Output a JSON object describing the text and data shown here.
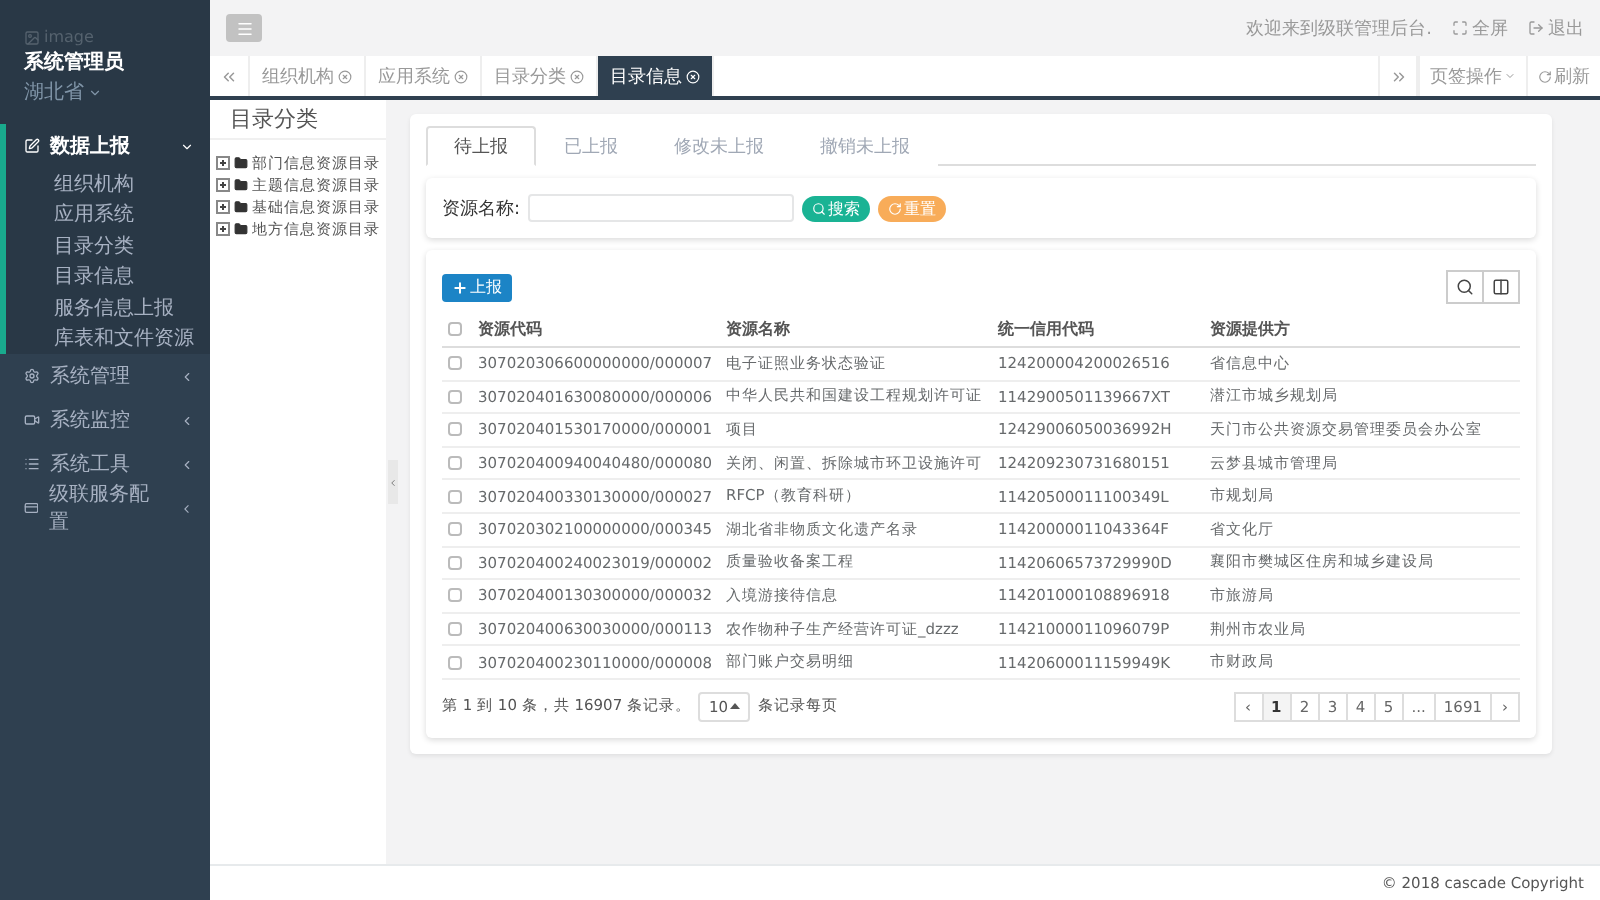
{
  "sidebar": {
    "image_label": "image",
    "user_name": "系统管理员",
    "region": "湖北省",
    "menu": [
      {
        "label": "数据上报",
        "expanded": true,
        "children": [
          {
            "label": "组织机构"
          },
          {
            "label": "应用系统"
          },
          {
            "label": "目录分类"
          },
          {
            "label": "目录信息"
          },
          {
            "label": "服务信息上报"
          },
          {
            "label": "库表和文件资源"
          }
        ]
      },
      {
        "label": "系统管理",
        "expanded": false
      },
      {
        "label": "系统监控",
        "expanded": false
      },
      {
        "label": "系统工具",
        "expanded": false
      },
      {
        "label": "级联服务配置",
        "expanded": false
      }
    ]
  },
  "header": {
    "welcome": "欢迎来到级联管理后台.",
    "fullscreen": "全屏",
    "logout": "退出"
  },
  "page_tabs": [
    {
      "label": "组织机构",
      "selected": false
    },
    {
      "label": "应用系统",
      "selected": false
    },
    {
      "label": "目录分类",
      "selected": false
    },
    {
      "label": "目录信息",
      "selected": true
    }
  ],
  "tab_actions": {
    "menu": "页签操作",
    "refresh": "刷新"
  },
  "tree": {
    "title": "目录分类",
    "items": [
      {
        "label": "部门信息资源目录",
        "expanded": false
      },
      {
        "label": "主题信息资源目录",
        "expanded": false
      },
      {
        "label": "基础信息资源目录",
        "expanded": false
      },
      {
        "label": "地方信息资源目录",
        "expanded": false
      }
    ]
  },
  "report_tabs": [
    {
      "label": "待上报",
      "selected": true
    },
    {
      "label": "已上报",
      "selected": false
    },
    {
      "label": "修改未上报",
      "selected": false
    },
    {
      "label": "撤销未上报",
      "selected": false
    }
  ],
  "search": {
    "label": "资源名称:",
    "search_button": "搜索",
    "reset_button": "重置"
  },
  "report_button": "上报",
  "table": {
    "all_checked": false,
    "columns": [
      "资源代码",
      "资源名称",
      "统一信用代码",
      "资源提供方"
    ],
    "rows": [
      {
        "checked": false,
        "cells": [
          "307020306600000000/000007",
          "电子证照业务状态验证",
          "124200004200026516",
          "省信息中心"
        ]
      },
      {
        "checked": false,
        "cells": [
          "307020401630080000/000006",
          "中华人民共和国建设工程规划许可证",
          "1142900501139667XT",
          "潜江市城乡规划局"
        ]
      },
      {
        "checked": false,
        "cells": [
          "307020401530170000/000001",
          "项目",
          "12429006050036992H",
          "天门市公共资源交易管理委员会办公室"
        ]
      },
      {
        "checked": false,
        "cells": [
          "307020400940040480/000080",
          "关闭、闲置、拆除城市环卫设施许可",
          "124209230731680151",
          "云梦县城市管理局"
        ]
      },
      {
        "checked": false,
        "cells": [
          "307020400330130000/000027",
          "RFCP（教育科研）",
          "11420500011100349L",
          "市规划局"
        ]
      },
      {
        "checked": false,
        "cells": [
          "307020302100000000/000345",
          "湖北省非物质文化遗产名录",
          "11420000011043364F",
          "省文化厅"
        ]
      },
      {
        "checked": false,
        "cells": [
          "307020400240023019/000002",
          "质量验收备案工程",
          "11420606573729990D",
          "襄阳市樊城区住房和城乡建设局"
        ]
      },
      {
        "checked": false,
        "cells": [
          "307020400130300000/000032",
          "入境游接待信息",
          "114201000108896918",
          "市旅游局"
        ]
      },
      {
        "checked": false,
        "cells": [
          "307020400630030000/000113",
          "农作物种子生产经营许可证_dzzz",
          "11421000011096079P",
          "荆州市农业局"
        ]
      },
      {
        "checked": false,
        "cells": [
          "307020400230110000/000008",
          "部门账户交易明细",
          "11420600011159949K",
          "市财政局"
        ]
      }
    ]
  },
  "pagination": {
    "summary": "第 1 到 10 条，共 16907 条记录。",
    "page_size": "10",
    "page_size_suffix": "条记录每页",
    "prev": "‹",
    "next": "›",
    "pages": [
      {
        "label": "1",
        "selected": true
      },
      {
        "label": "2",
        "selected": false
      },
      {
        "label": "3",
        "selected": false
      },
      {
        "label": "4",
        "selected": false
      },
      {
        "label": "5",
        "selected": false
      },
      {
        "label": "...",
        "selected": false
      },
      {
        "label": "1691",
        "selected": false
      }
    ]
  },
  "footer": "© 2018 cascade Copyright"
}
